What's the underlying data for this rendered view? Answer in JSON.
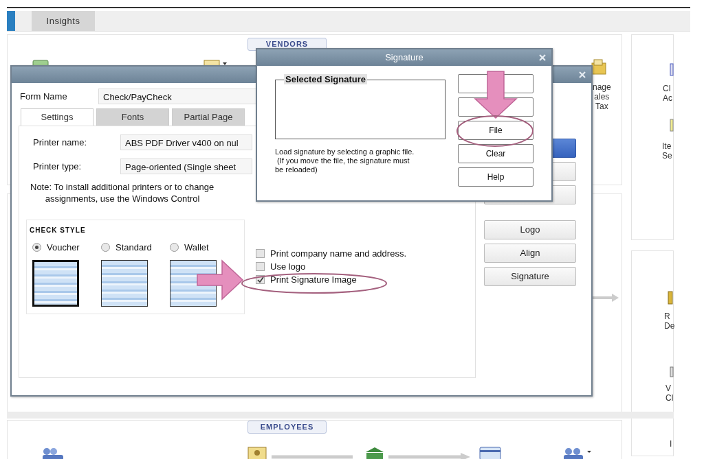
{
  "app_tabs": [
    {
      "label": "Insights",
      "selected": false
    }
  ],
  "vendors_section": {
    "label": "VENDORS",
    "items": [
      {
        "lines": [
          "nage",
          "ales",
          "Tax"
        ]
      }
    ]
  },
  "side_items": [
    {
      "lines": [
        "Cl",
        "Ac"
      ]
    },
    {
      "lines": [
        "Ite",
        "Se"
      ]
    },
    {
      "lines": [
        "R",
        "De"
      ]
    },
    {
      "lines": [
        "V",
        "Cl"
      ]
    },
    {
      "lines": [
        "I"
      ]
    }
  ],
  "employees_section": {
    "label": "EMPLOYEES"
  },
  "print_dialog": {
    "form_name_label": "Form Name",
    "form_name": "Check/PayCheck",
    "tabs": [
      {
        "label": "Settings",
        "selected": true
      },
      {
        "label": "Fonts",
        "selected": false
      },
      {
        "label": "Partial Page",
        "selected": false
      }
    ],
    "printer_name_label": "Printer name:",
    "printer_name": "ABS PDF Driver v400 on nul",
    "printer_type_label": "Printer type:",
    "printer_type": "Page-oriented (Single sheet",
    "note": "Note: To install additional printers or to change\n      assignments, use the Windows Control",
    "check_style": {
      "title": "CHECK STYLE",
      "options": [
        {
          "label": "Voucher",
          "selected": true
        },
        {
          "label": "Standard",
          "selected": false
        },
        {
          "label": "Wallet",
          "selected": false
        }
      ]
    },
    "options": [
      {
        "label": "Print company name and address.",
        "checked": false
      },
      {
        "label": "Use logo",
        "checked": false
      },
      {
        "label": "Print Signature Image",
        "checked": true
      }
    ],
    "buttons": [
      {
        "kind": "primary"
      },
      {
        "kind": "plain"
      },
      {
        "kind": "plain"
      },
      {
        "kind": "plain",
        "label": "Logo"
      },
      {
        "kind": "plain",
        "label": "Align"
      },
      {
        "kind": "plain",
        "label": "Signature"
      }
    ]
  },
  "signature_dialog": {
    "title": "Signature",
    "group_title": "Selected Signature",
    "help": "Load signature by selecting a graphic file.\n (If you move the file, the signature must\nbe reloaded)",
    "buttons": [
      {
        "kind": "blank"
      },
      {
        "kind": "blank"
      },
      {
        "kind": "text",
        "label": "File"
      },
      {
        "kind": "text",
        "label": "Clear"
      },
      {
        "kind": "text",
        "label": "Help"
      }
    ]
  }
}
